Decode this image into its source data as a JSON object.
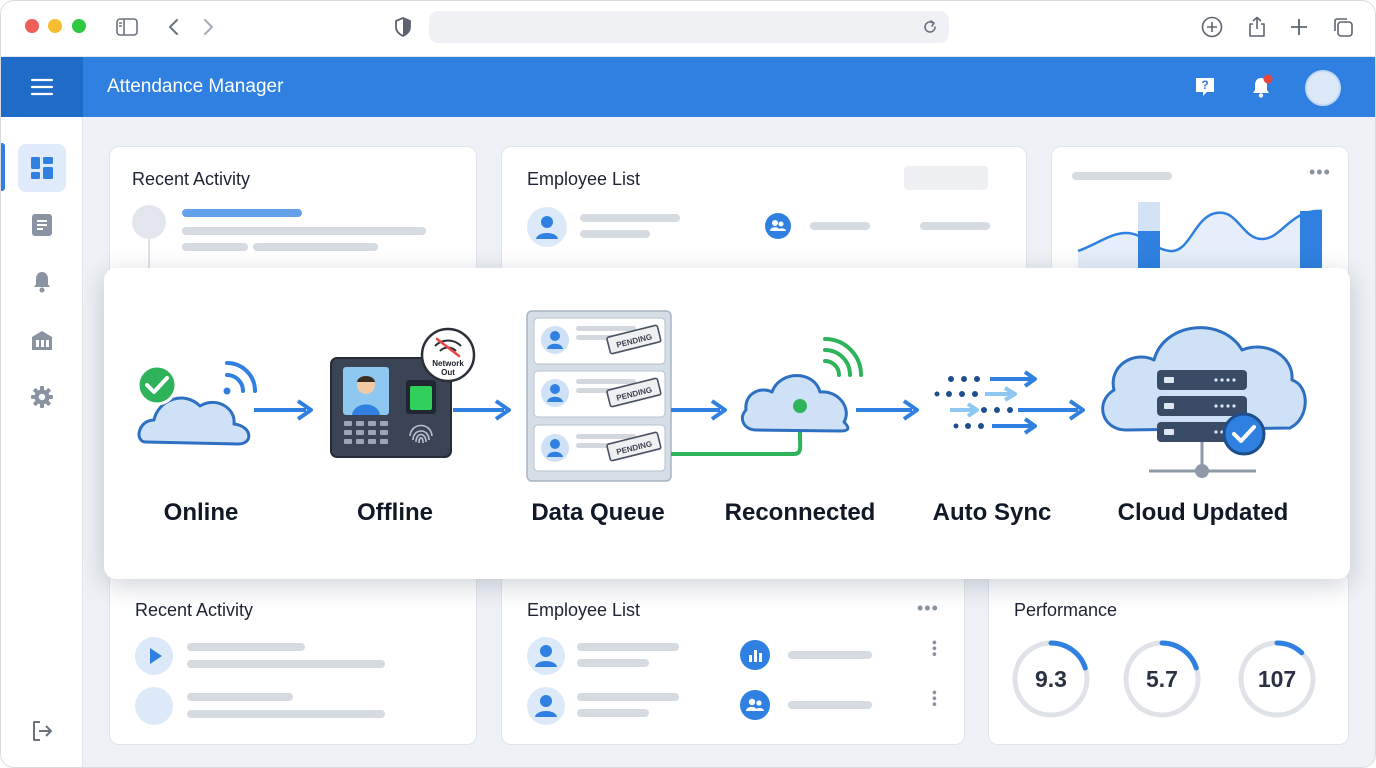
{
  "browser": {
    "traffic_lights": [
      "#ee5f57",
      "#f5bd2f",
      "#2fc841"
    ],
    "icons": [
      "sidebar-toggle-icon",
      "back-icon",
      "forward-icon",
      "shield-icon",
      "reload-icon",
      "download-icon",
      "share-icon",
      "new-tab-icon",
      "tabs-overview-icon"
    ]
  },
  "app": {
    "title": "Attendance Manager",
    "accent": "#2f80e0",
    "header_icons": [
      "help-icon",
      "bell-icon",
      "avatar"
    ],
    "notification_dot_color": "#e8473f"
  },
  "sidebar": {
    "items": [
      {
        "icon": "dashboard-icon",
        "active": true
      },
      {
        "icon": "report-icon",
        "active": false
      },
      {
        "icon": "bell-icon",
        "active": false
      },
      {
        "icon": "building-icon",
        "active": false
      },
      {
        "icon": "settings-icon",
        "active": false
      }
    ],
    "footer_icon": "logout-icon"
  },
  "top_cards": {
    "recent_activity": {
      "title": "Recent Activity"
    },
    "employee_list": {
      "title": "Employee List"
    }
  },
  "workflow": {
    "steps": [
      {
        "label": "Online",
        "icon": "cloud-wifi-check-icon"
      },
      {
        "label": "Offline",
        "icon": "biometric-terminal-icon"
      },
      {
        "label": "Data Queue",
        "icon": "pending-records-icon"
      },
      {
        "label": "Reconnected",
        "icon": "cloud-reconnect-icon"
      },
      {
        "label": "Auto Sync",
        "icon": "sync-arrows-icon"
      },
      {
        "label": "Cloud Updated",
        "icon": "cloud-server-check-icon"
      }
    ],
    "badge": {
      "line1": "Network",
      "line2": "Out"
    },
    "pending_label": "PENDING"
  },
  "bottom_cards": {
    "recent_activity": {
      "title": "Recent Activity"
    },
    "employee_list": {
      "title": "Employee List"
    },
    "performance": {
      "title": "Performance",
      "metrics": [
        {
          "value": "9.3",
          "progress": 0.2
        },
        {
          "value": "5.7",
          "progress": 0.2
        },
        {
          "value": "107",
          "progress": 0.12
        }
      ]
    }
  }
}
